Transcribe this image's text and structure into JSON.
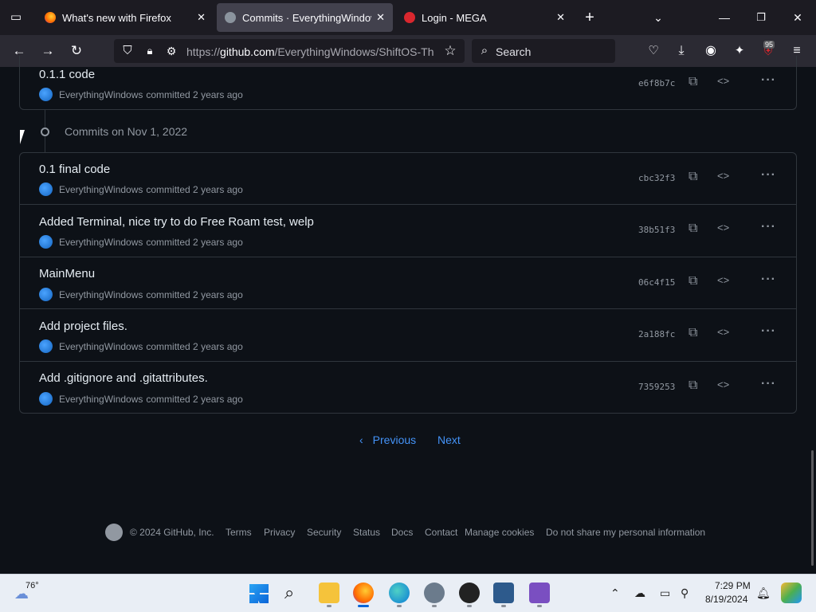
{
  "browser": {
    "tabs": [
      {
        "title": "What's new with Firefox",
        "active": false
      },
      {
        "title": "Commits · EverythingWindows",
        "active": true
      },
      {
        "title": "Login - MEGA",
        "active": false
      }
    ],
    "url_prefix": "https://",
    "url_host": "github.com",
    "url_path": "/EverythingWindows/ShiftOS-Th",
    "search_placeholder": "Search",
    "extension_badge": "95"
  },
  "commits_top": [
    {
      "message": "0.1.1 code",
      "author": "EverythingWindows",
      "when": "committed 2 years ago",
      "sha": "e6f8b7c"
    }
  ],
  "group": {
    "heading": "Commits on Nov 1, 2022"
  },
  "commits": [
    {
      "message": "0.1 final code",
      "author": "EverythingWindows",
      "when": "committed 2 years ago",
      "sha": "cbc32f3"
    },
    {
      "message": "Added Terminal, nice try to do Free Roam test, welp",
      "author": "EverythingWindows",
      "when": "committed 2 years ago",
      "sha": "38b51f3"
    },
    {
      "message": "MainMenu",
      "author": "EverythingWindows",
      "when": "committed 2 years ago",
      "sha": "06c4f15"
    },
    {
      "message": "Add project files.",
      "author": "EverythingWindows",
      "when": "committed 2 years ago",
      "sha": "2a188fc"
    },
    {
      "message": "Add .gitignore and .gitattributes.",
      "author": "EverythingWindows",
      "when": "committed 2 years ago",
      "sha": "7359253"
    }
  ],
  "pagination": {
    "previous": "Previous",
    "next": "Next"
  },
  "footer": {
    "copyright": "© 2024 GitHub, Inc.",
    "links": [
      "Terms",
      "Privacy",
      "Security",
      "Status",
      "Docs",
      "Contact",
      "Manage cookies",
      "Do not share my personal information"
    ]
  },
  "taskbar": {
    "weather_temp": "76°",
    "time": "7:29 PM",
    "date": "8/19/2024"
  },
  "colors": {
    "page_bg": "#0d1117",
    "border": "#30363d",
    "link": "#4493f8",
    "muted": "#9198a1"
  }
}
